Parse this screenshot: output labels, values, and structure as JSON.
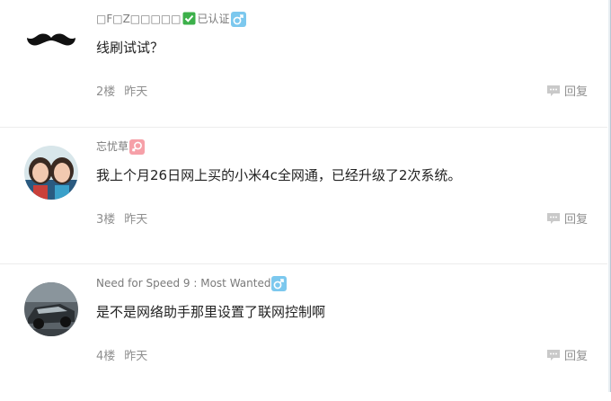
{
  "comments": [
    {
      "username": "□F□Z□□□□□",
      "verified_label": "已认证",
      "gender_icon": "male-icon",
      "text": "线刷试试？",
      "floor": "2楼",
      "time": "昨天",
      "reply_label": "回复",
      "avatar": "mustache-avatar"
    },
    {
      "username": "忘忧草",
      "gender_icon": "female-icon",
      "text": "我上个月26日网上买的小米4c全网通，已经升级了2次系统。",
      "floor": "3楼",
      "time": "昨天",
      "reply_label": "回复",
      "avatar": "photo-avatar"
    },
    {
      "username": "Need for Speed 9 : Most Wanted",
      "gender_icon": "male-icon",
      "text": "是不是网络助手那里设置了联网控制啊",
      "floor": "4楼",
      "time": "昨天",
      "reply_label": "回复",
      "avatar": "car-avatar"
    }
  ],
  "colors": {
    "male_badge": "#7cc8ee",
    "female_badge": "#f6a0a8",
    "verified_badge": "#3cb04a"
  }
}
